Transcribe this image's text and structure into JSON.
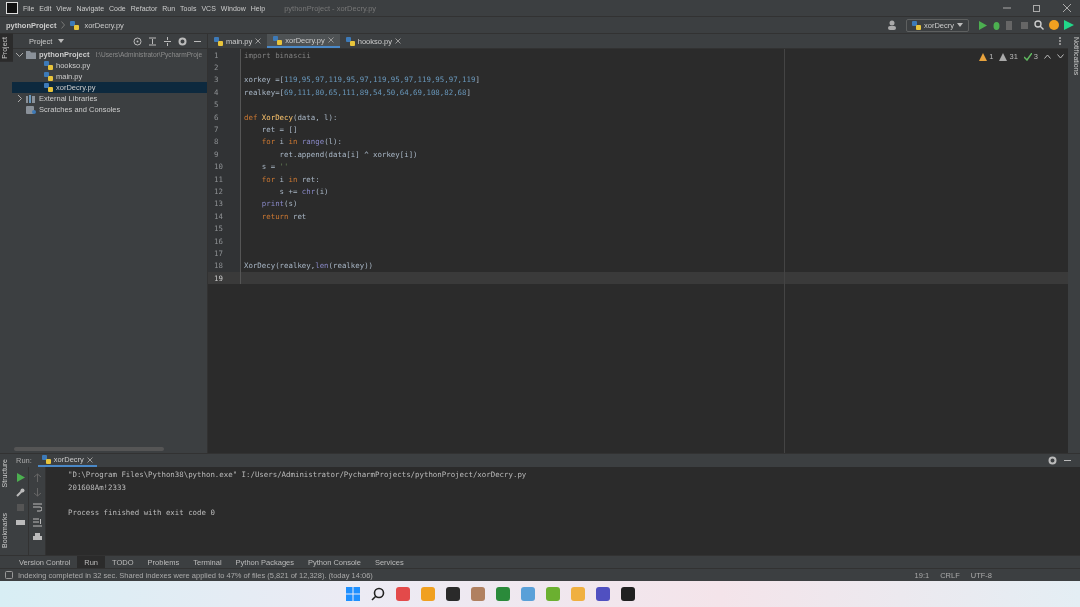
{
  "window": {
    "title": "pythonProject - xorDecry.py"
  },
  "menu": [
    "File",
    "Edit",
    "View",
    "Navigate",
    "Code",
    "Refactor",
    "Run",
    "Tools",
    "VCS",
    "Window",
    "Help"
  ],
  "breadcrumbs": [
    "pythonProject",
    "xorDecry.py"
  ],
  "run_config": "xorDecry",
  "project_panel": {
    "title": "Project",
    "side_tab": "Project",
    "tree": [
      {
        "label": "pythonProject",
        "path": "I:\\Users\\Administrator\\PycharmProje",
        "kind": "folder",
        "expanded": true,
        "selected": false,
        "children": [
          {
            "label": "hookso.py",
            "selected": false
          },
          {
            "label": "main.py",
            "selected": false
          },
          {
            "label": "xorDecry.py",
            "selected": true
          }
        ]
      },
      {
        "label": "External Libraries",
        "kind": "library",
        "expanded": false,
        "selected": false
      },
      {
        "label": "Scratches and Consoles",
        "kind": "scratch",
        "selected": false
      }
    ]
  },
  "editor_tabs": [
    {
      "label": "main.py",
      "selected": false
    },
    {
      "label": "xorDecry.py",
      "selected": true
    },
    {
      "label": "hookso.py",
      "selected": false
    }
  ],
  "inspections": [
    {
      "kind": "warning",
      "count": "1"
    },
    {
      "kind": "weak",
      "count": "31"
    },
    {
      "kind": "typo",
      "count": "3"
    }
  ],
  "code": [
    {
      "n": "1",
      "current": false,
      "tokens": [
        {
          "text": "import binascii",
          "kind": "dim"
        }
      ]
    },
    {
      "n": "2",
      "current": false
    },
    {
      "n": "3",
      "current": false,
      "tokens": [
        {
          "text": "xorkey",
          "kind": "plain"
        },
        {
          "text": " =[",
          "kind": "plain"
        },
        {
          "text": "119,95,97,119,95,97,119,95,97,119,95,97,119",
          "kind": "num"
        },
        {
          "text": "]",
          "kind": "plain"
        }
      ]
    },
    {
      "n": "4",
      "current": false,
      "tokens": [
        {
          "text": "realkey=[",
          "kind": "plain"
        },
        {
          "text": "69,111,80,65,111,89,54,50,64,69,108,82,68",
          "kind": "num"
        },
        {
          "text": "]",
          "kind": "plain"
        }
      ]
    },
    {
      "n": "5",
      "current": false
    },
    {
      "n": "6",
      "current": false,
      "tokens": [
        {
          "text": "def ",
          "kind": "kw"
        },
        {
          "text": "XorDecy",
          "kind": "fn"
        },
        {
          "text": "(data, l):",
          "kind": "plain"
        }
      ]
    },
    {
      "n": "7",
      "current": false,
      "tokens": [
        {
          "text": "    ret = []",
          "kind": "plain"
        }
      ]
    },
    {
      "n": "8",
      "current": false,
      "tokens": [
        {
          "text": "    for ",
          "kind": "kw"
        },
        {
          "text": "i ",
          "kind": "plain"
        },
        {
          "text": "in ",
          "kind": "kw"
        },
        {
          "text": "range",
          "kind": "builtin"
        },
        {
          "text": "(l):",
          "kind": "plain"
        }
      ]
    },
    {
      "n": "9",
      "current": false,
      "tokens": [
        {
          "text": "        ret.append(data[i] ^ xorkey[i])",
          "kind": "plain"
        }
      ]
    },
    {
      "n": "10",
      "current": false,
      "tokens": [
        {
          "text": "    s = ",
          "kind": "plain"
        },
        {
          "text": "''",
          "kind": "str"
        }
      ]
    },
    {
      "n": "11",
      "current": false,
      "tokens": [
        {
          "text": "    for ",
          "kind": "kw"
        },
        {
          "text": "i ",
          "kind": "plain"
        },
        {
          "text": "in ",
          "kind": "kw"
        },
        {
          "text": "ret:",
          "kind": "plain"
        }
      ]
    },
    {
      "n": "12",
      "current": false,
      "tokens": [
        {
          "text": "        s += ",
          "kind": "plain"
        },
        {
          "text": "chr",
          "kind": "builtin"
        },
        {
          "text": "(i)",
          "kind": "plain"
        }
      ]
    },
    {
      "n": "13",
      "current": false,
      "tokens": [
        {
          "text": "    print",
          "kind": "builtin"
        },
        {
          "text": "(s)",
          "kind": "plain"
        }
      ]
    },
    {
      "n": "14",
      "current": false,
      "tokens": [
        {
          "text": "    return ",
          "kind": "kw"
        },
        {
          "text": "ret",
          "kind": "plain"
        }
      ]
    },
    {
      "n": "15",
      "current": false
    },
    {
      "n": "16",
      "current": false
    },
    {
      "n": "17",
      "current": false
    },
    {
      "n": "18",
      "current": false,
      "tokens": [
        {
          "text": "XorDecy(realkey,",
          "kind": "plain"
        },
        {
          "text": "len",
          "kind": "builtin"
        },
        {
          "text": "(realkey))",
          "kind": "plain"
        }
      ]
    },
    {
      "n": "19",
      "current": true
    }
  ],
  "run_panel": {
    "label": "Run:",
    "tab": "xorDecry",
    "output": [
      {
        "kind": "command",
        "text": "\"D:\\Program Files\\Python38\\python.exe\" I:/Users/Administrator/PycharmProjects/pythonProject/xorDecry.py"
      },
      {
        "kind": "stdout",
        "text": "201608Am!2333"
      },
      {
        "kind": "exit",
        "text": "Process finished with exit code 0"
      }
    ]
  },
  "side_tabs_left": [
    "Structure",
    "Bookmarks"
  ],
  "side_tab_right": "Notifications",
  "tool_tabs": [
    {
      "label": "Version Control",
      "selected": false
    },
    {
      "label": "Run",
      "selected": true
    },
    {
      "label": "TODO",
      "selected": false
    },
    {
      "label": "Problems",
      "selected": false
    },
    {
      "label": "Terminal",
      "selected": false
    },
    {
      "label": "Python Packages",
      "selected": false
    },
    {
      "label": "Python Console",
      "selected": false
    },
    {
      "label": "Services",
      "selected": false
    }
  ],
  "status": {
    "message": "Indexing completed in 32 sec. Shared indexes were applied to 47% of files (5,821 of 12,328). (today 14:06)",
    "items": [
      "19:1",
      "CRLF",
      "UTF-8"
    ]
  }
}
